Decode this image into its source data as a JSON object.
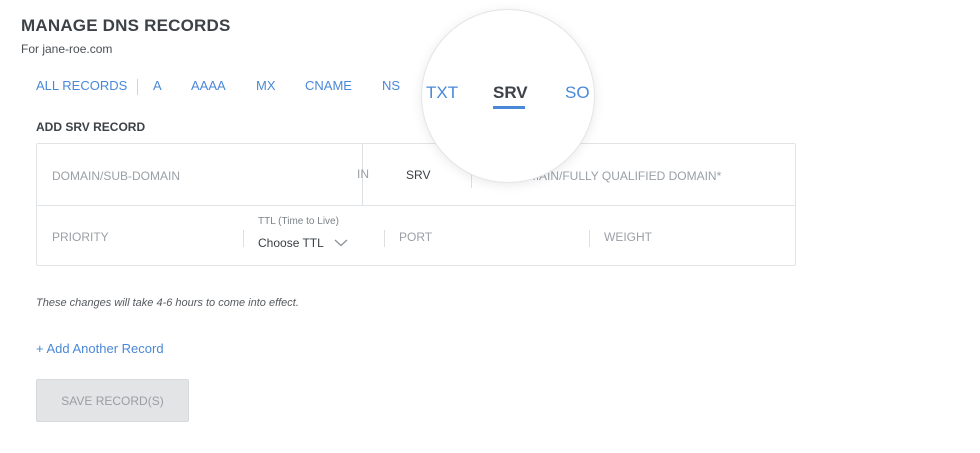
{
  "header": {
    "title": "MANAGE DNS RECORDS",
    "subtitle": "For jane-roe.com"
  },
  "tabs": [
    {
      "label": "ALL RECORDS"
    },
    {
      "label": "A"
    },
    {
      "label": "AAAA"
    },
    {
      "label": "MX"
    },
    {
      "label": "CNAME"
    },
    {
      "label": "NS"
    },
    {
      "label": "TXT"
    },
    {
      "label": "SRV",
      "active": true
    },
    {
      "label": "SO"
    }
  ],
  "form": {
    "section_title": "ADD SRV RECORD",
    "domain_placeholder": "DOMAIN/SUB-DOMAIN",
    "in_label": "IN",
    "type_value": "SRV",
    "target_placeholder": "MAIN/FULLY QUALIFIED DOMAIN*",
    "priority_placeholder": "PRIORITY",
    "ttl_label": "TTL (Time to Live)",
    "ttl_value": "Choose TTL",
    "port_placeholder": "PORT",
    "weight_placeholder": "WEIGHT"
  },
  "note": "These changes will take 4-6 hours to come into effect.",
  "add_link": "+ Add Another Record",
  "save_button": "SAVE RECORD(S)",
  "colors": {
    "accent": "#4a88d9",
    "title": "#3d4247",
    "placeholder": "#9aa0a6",
    "border": "#e1e4e7"
  },
  "icons": {
    "ttl_dropdown": "chevron-down-icon"
  }
}
